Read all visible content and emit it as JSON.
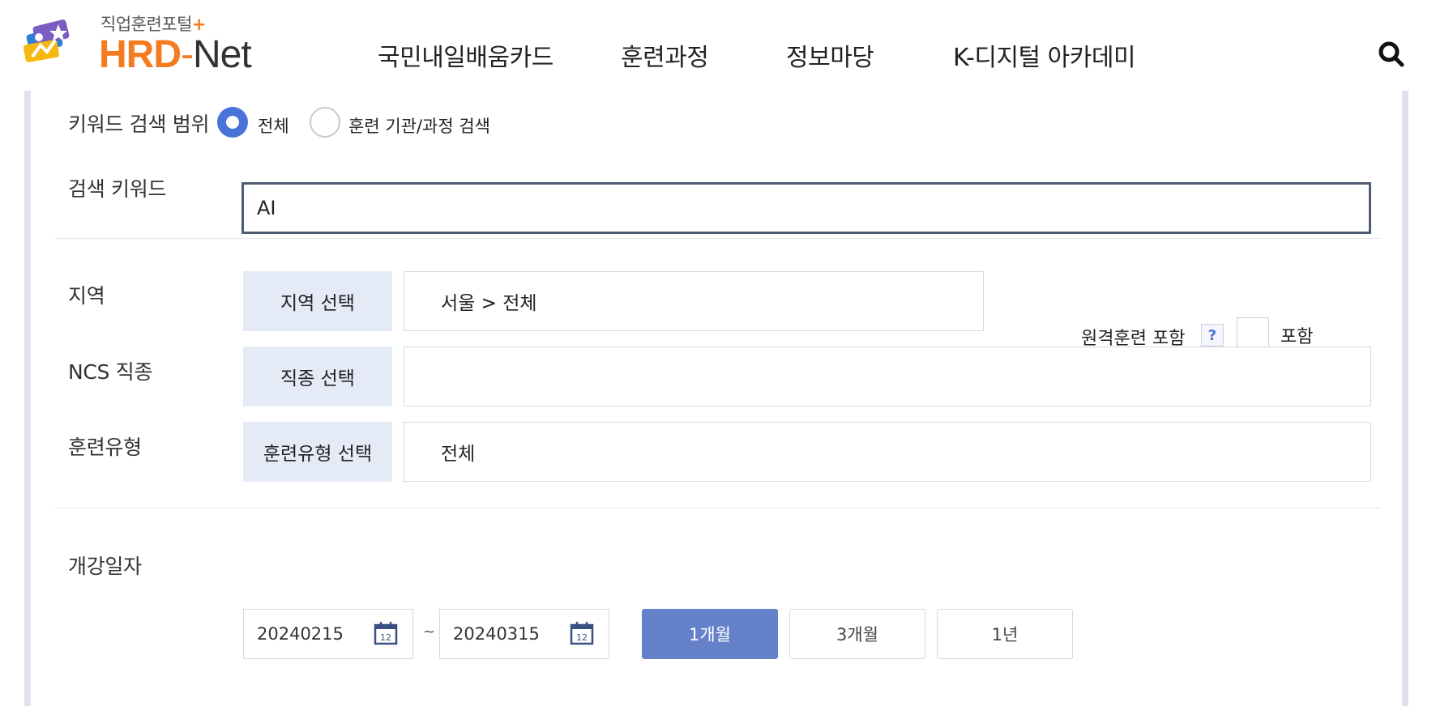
{
  "header": {
    "logo_sub": "직업훈련포털",
    "logo_plus": "+",
    "logo_hrd": "HRD",
    "logo_dash": "-",
    "logo_net": "Net",
    "nav": [
      "국민내일배움카드",
      "훈련과정",
      "정보마당",
      "K-디지털 아카데미"
    ],
    "search_icon": "search-icon"
  },
  "search": {
    "scope_label": "키워드 검색 범위",
    "scope_options": [
      "전체",
      "훈련 기관/과정 검색"
    ],
    "scope_selected": "전체",
    "keyword_label": "검색 키워드",
    "keyword_value": "AI"
  },
  "region": {
    "label": "지역",
    "button": "지역 선택",
    "value": "서울 > 전체",
    "remote_label": "원격훈련 포함",
    "help": "?",
    "checkbox_label": "포함",
    "checkbox_checked": false
  },
  "ncs": {
    "label": "NCS 직종",
    "button": "직종 선택",
    "value": ""
  },
  "training_type": {
    "label": "훈련유형",
    "button": "훈련유형 선택",
    "value": "전체"
  },
  "dates": {
    "label": "개강일자",
    "start": "20240215",
    "end": "20240315",
    "separator": "~",
    "calendar_icon_text": "12",
    "periods": [
      "1개월",
      "3개월",
      "1년"
    ],
    "active_period": "1개월"
  },
  "colors": {
    "brand_orange": "#f47b20",
    "accent_blue": "#4a73d9",
    "active_button": "#6581c9",
    "select_button_bg": "#e4ebf7",
    "panel_border": "#dde2ee"
  }
}
